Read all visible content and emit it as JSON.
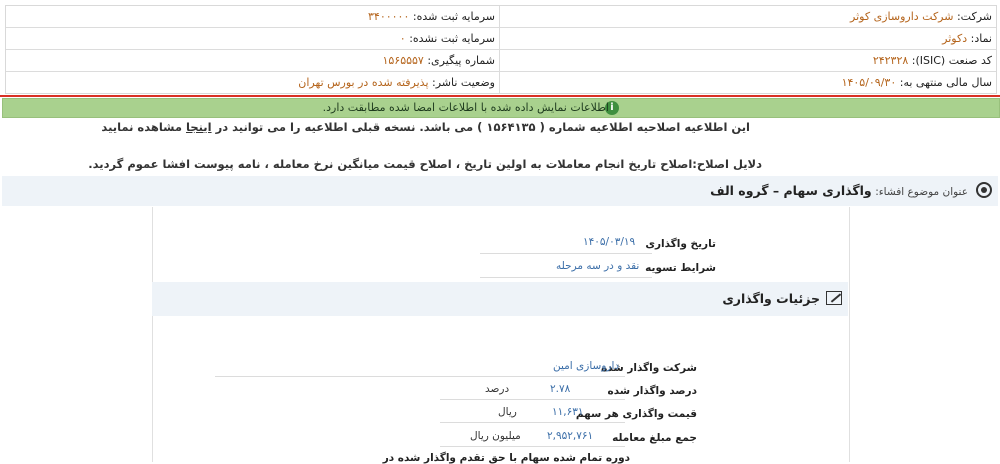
{
  "info": {
    "company_label": "شرکت:",
    "company_value": "شرکت داروسازی کوثر",
    "registered_capital_label": "سرمایه ثبت شده:",
    "registered_capital_value": "۳۴۰۰۰۰۰",
    "symbol_label": "نماد:",
    "symbol_value": "دکوثر",
    "unregistered_capital_label": "سرمایه ثبت نشده:",
    "unregistered_capital_value": "۰",
    "isic_label": "کد صنعت (ISIC):",
    "isic_value": "۲۴۲۳۲۸",
    "tracking_label": "شماره پیگیری:",
    "tracking_value": "۱۵۶۵۵۵۷",
    "fiscal_year_label": "سال مالی منتهی به:",
    "fiscal_year_value": "۱۴۰۵/۰۹/۳۰",
    "publisher_status_label": "وضعیت ناشر:",
    "publisher_status_value": "پذیرفته شده در بورس تهران"
  },
  "banner": {
    "text": "اطلاعات نمایش داده شده با اطلاعات امضا شده مطابقت دارد.",
    "icon": "info-icon"
  },
  "notice": {
    "line1_prefix": "این اطلاعیه اصلاحیه اطلاعیه شماره ( ۱۵۶۴۱۳۵ ) می باشد. نسخه قبلی اطلاعیه را می توانید در",
    "line1_link": "اینجا",
    "line1_suffix": "مشاهده نمایید",
    "line2": "دلایل اصلاح:اصلاح تاریخ انجام معاملات به اولین تاریخ ، اصلاح قیمت میانگین نرخ معامله ، نامه پیوست افشا عموم گردید."
  },
  "subject": {
    "label": "عنوان موضوع افشاء:",
    "title": "واگذاری سهام – گروه الف"
  },
  "fields": {
    "date_label": "تاریخ واگذاری",
    "date_value": "۱۴۰۵/۰۳/۱۹",
    "settlement_label": "شرایط تسویه",
    "settlement_value": "نقد و در سه مرحله"
  },
  "section": {
    "title": "جزئیات واگذاری"
  },
  "details": {
    "company_label": "شرکت واگذار شده",
    "company_value": "داروسازی امین",
    "percent_label": "درصد واگذار شده",
    "percent_value": "۲.۷۸",
    "percent_unit": "درصد",
    "price_label": "قیمت واگذاری هر سهم",
    "price_value": "۱۱,۶۳۱",
    "price_unit": "ریال",
    "total_label": "جمع مبلغ معامله",
    "total_value": "۲,۹۵۲,۷۶۱",
    "total_unit": "میلیون ریال",
    "cut_label": "دوره تمام شده سهام با حق تقدم واگذار شده در"
  }
}
